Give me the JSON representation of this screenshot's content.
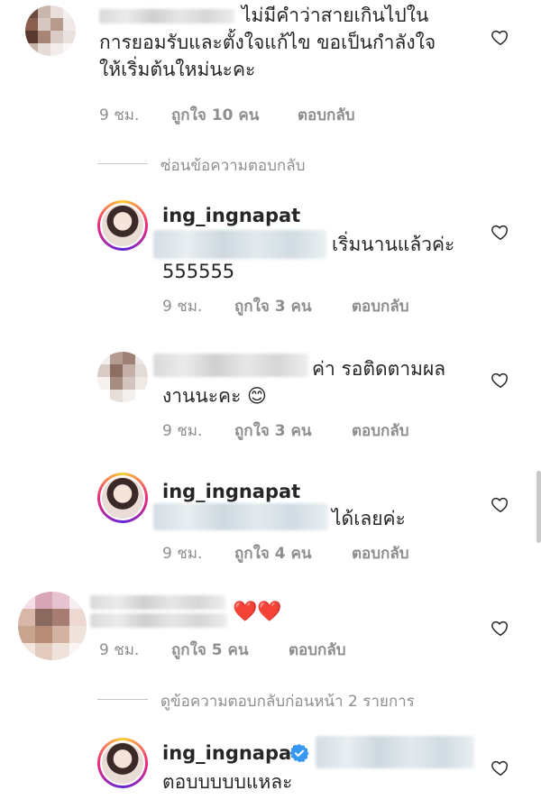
{
  "comments": [
    {
      "text": "ไม่มีคำว่าสายเกินไปในการยอมรับและตั้งใจแก้ไข ขอเป็นกำลังใจให้เริ่มต้นใหม่นะคะ",
      "line1": "ไม่มีคำว่าสายเกินไปใน",
      "line2": "การยอมรับและตั้งใจแก้ไข ขอเป็นกำลังใจ",
      "line3": "ให้เริ่มต้นใหม่นะคะ",
      "time": "9 ชม.",
      "likes": "ถูกใจ 10 คน",
      "reply": "ตอบกลับ"
    },
    {
      "hide_replies": "ซ่อนข้อความตอบกลับ"
    },
    {
      "username": "ing_ingnapat",
      "line1": "เริ่มนานแล้วค่ะ",
      "line2": "555555",
      "time": "9 ชม.",
      "likes": "ถูกใจ 3 คน",
      "reply": "ตอบกลับ"
    },
    {
      "line1": "ค่า รอติดตามผล",
      "line2": "งานนะคะ 😊",
      "time": "9 ชม.",
      "likes": "ถูกใจ 3 คน",
      "reply": "ตอบกลับ"
    },
    {
      "username": "ing_ingnapat",
      "line1": "ได้เลยค่ะ",
      "time": "9 ชม.",
      "likes": "ถูกใจ 4 คน",
      "reply": "ตอบกลับ"
    },
    {
      "line1": "❤️❤️",
      "time": "9 ชม.",
      "likes": "ถูกใจ 5 คน",
      "reply": "ตอบกลับ"
    },
    {
      "view_previous": "ดูข้อความตอบกลับก่อนหน้า 2 รายการ"
    },
    {
      "username": "ing_ingnapat",
      "line1": "ตอบบบบบแหละ"
    }
  ]
}
